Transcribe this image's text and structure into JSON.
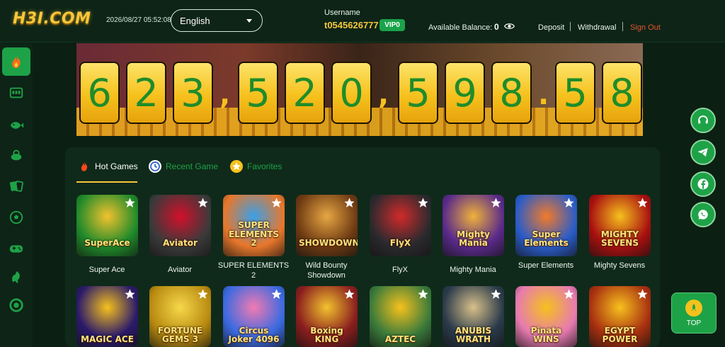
{
  "header": {
    "logo_text": "H3I.COM",
    "datetime": "2026/08/27 05:52:08",
    "language": "English",
    "username_caption": "Username",
    "username": "t0545626777",
    "vip_level": "VIP0",
    "balance_label": "Available Balance:",
    "balance_value": "0",
    "links": {
      "deposit": "Deposit",
      "withdrawal": "Withdrawal",
      "sign_out": "Sign Out"
    }
  },
  "sidebar": {
    "items": [
      {
        "icon": "fire-icon",
        "active": true
      },
      {
        "icon": "slot-machine-icon",
        "active": false
      },
      {
        "icon": "fish-icon",
        "active": false
      },
      {
        "icon": "lottery-icon",
        "active": false
      },
      {
        "icon": "cards-icon",
        "active": false
      },
      {
        "icon": "soccer-ball-icon",
        "active": false
      },
      {
        "icon": "gamepad-icon",
        "active": false
      },
      {
        "icon": "rooster-icon",
        "active": false
      },
      {
        "icon": "chip-icon",
        "active": false
      }
    ]
  },
  "jackpot": {
    "digits": [
      "6",
      "2",
      "3",
      "5",
      "2",
      "0",
      "5",
      "9",
      "8",
      "5",
      "8"
    ],
    "separators": [
      ",",
      ",",
      "."
    ],
    "display": "623,520,598.58"
  },
  "tabs": [
    {
      "label": "Hot Games",
      "icon": "fire-icon",
      "active": true
    },
    {
      "label": "Recent Game",
      "icon": "clock-icon",
      "active": false
    },
    {
      "label": "Favorites",
      "icon": "star-icon",
      "active": false
    }
  ],
  "games_row1": [
    {
      "name": "Super Ace",
      "tile_text": "SuperAce",
      "bg": "#1f8a2a",
      "accent": "#f2c22e"
    },
    {
      "name": "Aviator",
      "tile_text": "Aviator",
      "bg": "#3a3a3a",
      "accent": "#d3102b"
    },
    {
      "name": "SUPER ELEMENTS 2",
      "tile_text": "SUPER ELEMENTS 2",
      "bg": "#e8772b",
      "accent": "#3aa0e8"
    },
    {
      "name": "Wild Bounty Showdown",
      "tile_text": "SHOWDOWN",
      "bg": "#6e3a12",
      "accent": "#e7a744"
    },
    {
      "name": "FlyX",
      "tile_text": "FlyX",
      "bg": "#2a2a2e",
      "accent": "#d22a2a"
    },
    {
      "name": "Mighty Mania",
      "tile_text": "Mighty Mania",
      "bg": "#5a2a8a",
      "accent": "#f0b23a"
    },
    {
      "name": "Super Elements",
      "tile_text": "Super Elements",
      "bg": "#2a5cc8",
      "accent": "#f27a2a"
    },
    {
      "name": "Mighty Sevens",
      "tile_text": "MIGHTY SEVENS",
      "bg": "#a81010",
      "accent": "#f6c11d"
    }
  ],
  "games_row2": [
    {
      "name": "Magic Ace Wild Lock",
      "tile_text": "MAGIC ACE",
      "bg": "#2a1a6a",
      "accent": "#f6c11d"
    },
    {
      "name": "Fortune Gems 3",
      "tile_text": "FORTUNE GEMS 3",
      "bg": "#b88a10",
      "accent": "#f6d84a"
    },
    {
      "name": "Circus Joker 4096",
      "tile_text": "Circus Joker 4096",
      "bg": "#3a6ae0",
      "accent": "#f27ab2"
    },
    {
      "name": "Boxing King",
      "tile_text": "Boxing KING",
      "bg": "#8a1e1e",
      "accent": "#f2c22e"
    },
    {
      "name": "Aztec",
      "tile_text": "AZTEC",
      "bg": "#3a7a3a",
      "accent": "#f6c11d"
    },
    {
      "name": "Anubis Wrath",
      "tile_text": "ANUBIS WRATH",
      "bg": "#2a3a4a",
      "accent": "#d8c08a"
    },
    {
      "name": "Pinata Wins",
      "tile_text": "Pinata WINS",
      "bg": "#e67ab0",
      "accent": "#f6c11d"
    },
    {
      "name": "Egypt Power",
      "tile_text": "EGYPT POWER",
      "bg": "#a83010",
      "accent": "#f6c11d"
    }
  ],
  "float_buttons": [
    {
      "icon": "support-icon"
    },
    {
      "icon": "telegram-icon"
    },
    {
      "icon": "facebook-icon"
    },
    {
      "icon": "whatsapp-icon"
    }
  ],
  "top_button": {
    "label": "TOP"
  },
  "colors": {
    "accent_green": "#1ea247",
    "gold": "#f6c73a",
    "bg_dark": "#0b1f13",
    "sign_out": "#e8542c"
  }
}
